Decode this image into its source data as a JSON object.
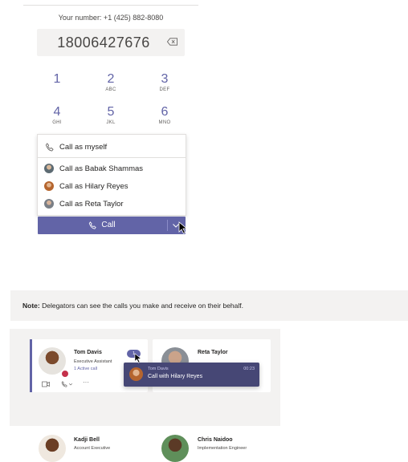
{
  "dialer": {
    "your_number": "Your number: +1 (425) 882-8080",
    "entered_number": "18006427676",
    "keys": [
      {
        "digit": "1",
        "letters": ""
      },
      {
        "digit": "2",
        "letters": "ABC"
      },
      {
        "digit": "3",
        "letters": "DEF"
      },
      {
        "digit": "4",
        "letters": "GHI"
      },
      {
        "digit": "5",
        "letters": "JKL"
      },
      {
        "digit": "6",
        "letters": "MNO"
      }
    ]
  },
  "call_menu": {
    "items": [
      {
        "label": "Call as myself"
      },
      {
        "label": "Call as Babak Shammas"
      },
      {
        "label": "Call as Hilary Reyes"
      },
      {
        "label": "Call as Reta Taylor"
      }
    ]
  },
  "call_button": {
    "label": "Call"
  },
  "note": {
    "bold": "Note:",
    "text": " Delegators can see the calls you make and receive on their behalf."
  },
  "contacts": [
    {
      "name": "Tom Davis",
      "role": "Executive Assistant",
      "status": "1 Active call"
    },
    {
      "name": "Reta Taylor",
      "role": ""
    },
    {
      "name": "Kadji Bell",
      "role": "Account Executive"
    },
    {
      "name": "Chris Naidoo",
      "role": "Implementation Engineer"
    }
  ],
  "badge": {
    "text": "1"
  },
  "tooltip": {
    "caller": "Tom Davis",
    "text": "Call with Hilary Reyes",
    "time": "00:23"
  },
  "colors": {
    "accent": "#6264a7",
    "tooltip_bg": "#464775",
    "note_bg": "#f3f2f1"
  }
}
